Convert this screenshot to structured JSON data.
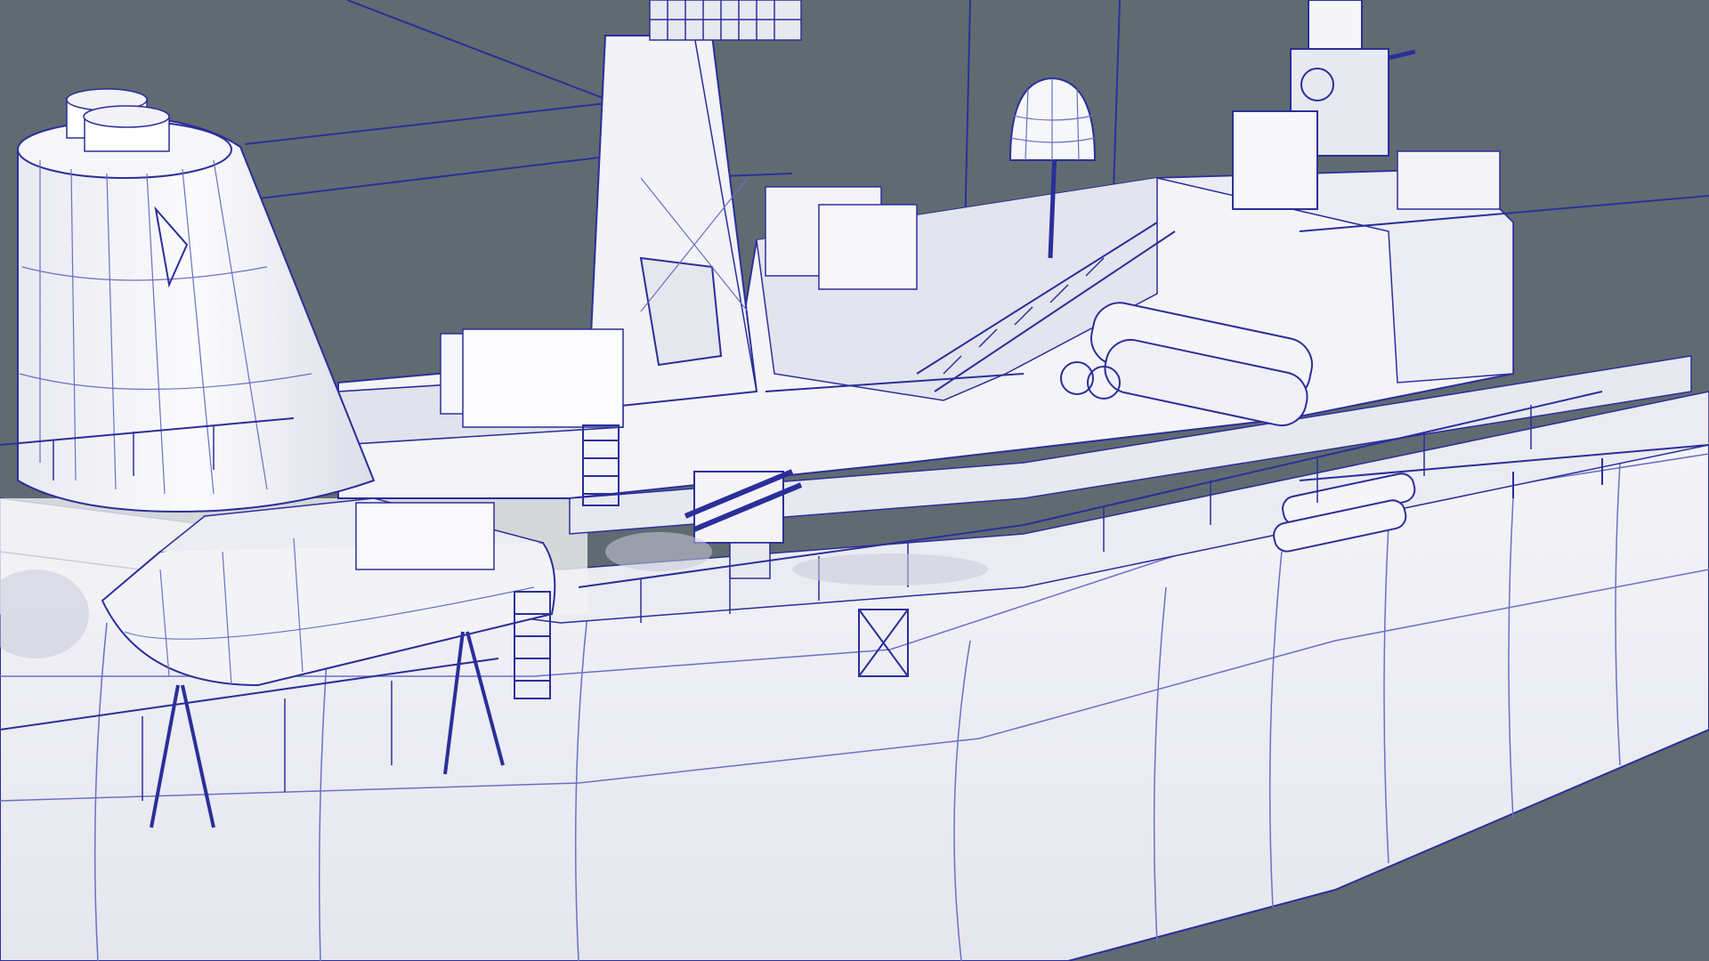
{
  "scene": {
    "kind": "wireframe-render",
    "subject": "naval-ship-3d-model",
    "colors": {
      "background": "#5f6b71",
      "surface": "#f6f6f9",
      "surface_shade": "#e3e3ec",
      "surface_dark": "#cfd0dc",
      "shadow": "#b9bcce",
      "wire": "#2a2f9a",
      "wire_light": "#6b70c4"
    },
    "parts": [
      "funnel",
      "main-mast",
      "radar-antenna",
      "radome",
      "superstructure",
      "lifeboat",
      "torpedo-tubes",
      "chaff-launcher",
      "ciws-mount",
      "hull",
      "railings",
      "ladders",
      "rigging-wires"
    ]
  }
}
